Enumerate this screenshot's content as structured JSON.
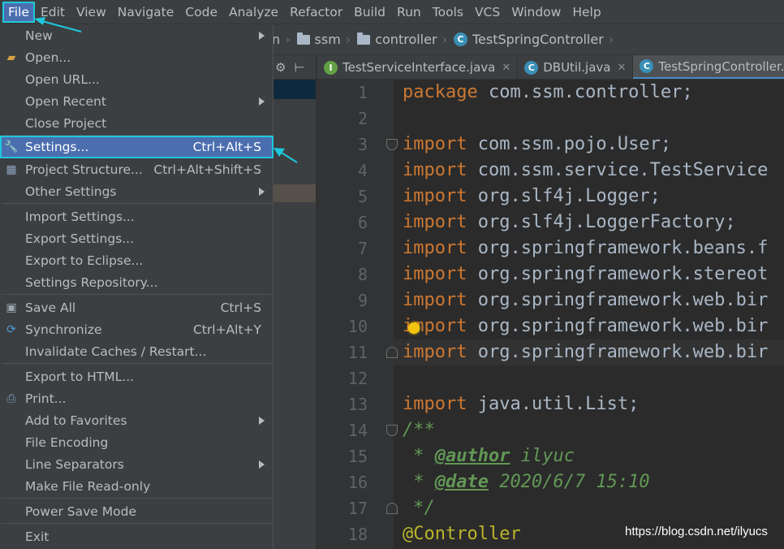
{
  "menubar": [
    "File",
    "Edit",
    "View",
    "Navigate",
    "Code",
    "Analyze",
    "Refactor",
    "Build",
    "Run",
    "Tools",
    "VCS",
    "Window",
    "Help"
  ],
  "breadcrumb": {
    "partial": "n",
    "folder1": "ssm",
    "folder2": "controller",
    "class": "TestSpringController"
  },
  "tabs": [
    {
      "label": "TestServiceInterface.java",
      "icon": "I"
    },
    {
      "label": "DBUtil.java",
      "icon": "C"
    },
    {
      "label": "TestSpringController.java",
      "icon": "C"
    }
  ],
  "file_menu": {
    "new": "New",
    "open": "Open...",
    "open_url": "Open URL...",
    "open_recent": "Open Recent",
    "close_project": "Close Project",
    "settings": "Settings...",
    "settings_sc": "Ctrl+Alt+S",
    "project_structure": "Project Structure...",
    "project_structure_sc": "Ctrl+Alt+Shift+S",
    "other_settings": "Other Settings",
    "import_settings": "Import Settings...",
    "export_settings": "Export Settings...",
    "export_eclipse": "Export to Eclipse...",
    "settings_repo": "Settings Repository...",
    "save_all": "Save All",
    "save_all_sc": "Ctrl+S",
    "synchronize": "Synchronize",
    "synchronize_sc": "Ctrl+Alt+Y",
    "invalidate": "Invalidate Caches / Restart...",
    "export_html": "Export to HTML...",
    "print": "Print...",
    "add_favorites": "Add to Favorites",
    "file_encoding": "File Encoding",
    "line_separators": "Line Separators",
    "make_readonly": "Make File Read-only",
    "power_save": "Power Save Mode",
    "exit": "Exit"
  },
  "code": {
    "line_numbers": [
      "1",
      "2",
      "3",
      "4",
      "5",
      "6",
      "7",
      "8",
      "9",
      "10",
      "11",
      "12",
      "13",
      "14",
      "15",
      "16",
      "17",
      "18"
    ],
    "l1_kw": "package",
    "l1_rest": " com.ssm.controller;",
    "import_kw": "import",
    "l3": " com.ssm.pojo.User;",
    "l4": " com.ssm.service.TestService",
    "l5": " org.slf4j.Logger;",
    "l6": " org.slf4j.LoggerFactory;",
    "l7": " org.springframework.beans.f",
    "l8": " org.springframework.stereot",
    "l9": " org.springframework.web.bir",
    "l10": " org.springframework.web.bir",
    "l11": " org.springframework.web.bir",
    "l13": " java.util.List;",
    "l14": "/**",
    "l15_star": " * ",
    "l15_tag": "@author",
    "l15_val": " ilyuc",
    "l16_star": " * ",
    "l16_tag": "@date",
    "l16_val": " 2020/6/7 15:10",
    "l17": " */",
    "l18": "@Controller"
  },
  "watermark": "https://blog.csdn.net/ilyucs",
  "colors": {
    "accent_highlight": "#1ec8dc",
    "selection": "#4b6eaf",
    "keyword": "#cc7832"
  }
}
